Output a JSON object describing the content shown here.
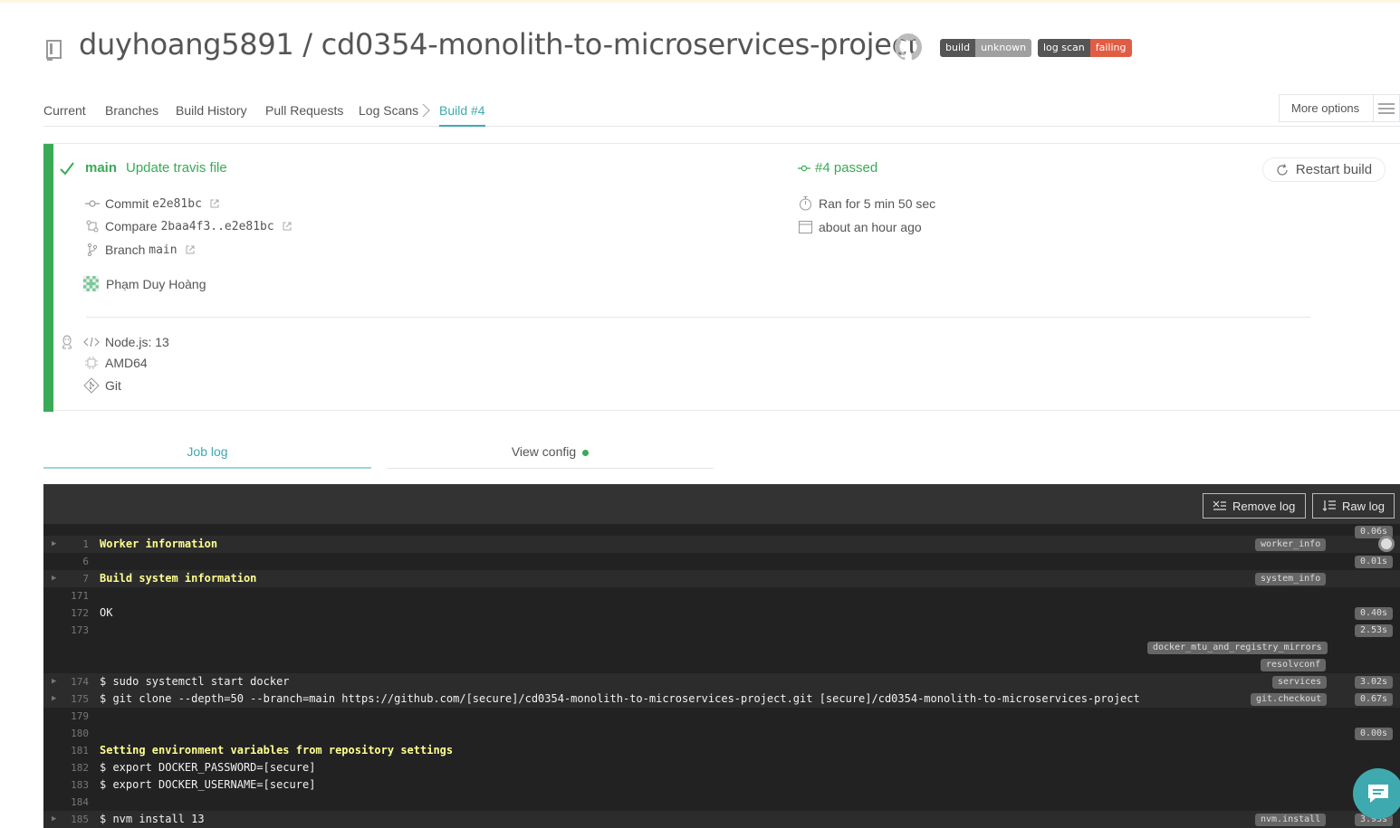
{
  "header": {
    "owner": "duyhoang5891",
    "separator": " / ",
    "repo": "cd0354-monolith-to-microservices-project",
    "badges": [
      {
        "key": "build",
        "value": "unknown",
        "color": "#9f9f9f"
      },
      {
        "key": "log scan",
        "value": "failing",
        "color": "#e05d44"
      }
    ]
  },
  "nav": {
    "tabs": [
      "Current",
      "Branches",
      "Build History",
      "Pull Requests",
      "Log Scans",
      "Build #4"
    ],
    "active": "Build #4",
    "more_options": "More options"
  },
  "build": {
    "status_color": "#39aa56",
    "branch": "main",
    "message": "Update travis file",
    "commit_label": "Commit",
    "commit": "e2e81bc",
    "compare_label": "Compare",
    "compare": "2baa4f3..e2e81bc",
    "branch_label": "Branch",
    "branch_value": "main",
    "author": "Phạm Duy Hoàng",
    "number_status": "#4 passed",
    "duration": "Ran for 5 min 50 sec",
    "finished": "about an hour ago",
    "restart": "Restart build",
    "env": {
      "language": "Node.js: 13",
      "arch": "AMD64",
      "vcs": "Git"
    }
  },
  "log_tabs": {
    "job_log": "Job log",
    "view_config": "View config"
  },
  "log": {
    "remove": "Remove log",
    "raw": "Raw log",
    "lines": [
      {
        "n": "1",
        "text": "Worker information",
        "hl": true,
        "fold": true
      },
      {
        "n": "6",
        "text": ""
      },
      {
        "n": "7",
        "text": "Build system information",
        "hl": true,
        "fold": true
      },
      {
        "n": "171",
        "text": ""
      },
      {
        "n": "172",
        "text": "OK"
      },
      {
        "n": "173",
        "text": ""
      },
      {
        "n": "174",
        "text": "$ sudo systemctl start docker",
        "fold": true
      },
      {
        "n": "175",
        "text": "$ git clone --depth=50 --branch=main https://github.com/[secure]/cd0354-monolith-to-microservices-project.git [secure]/cd0354-monolith-to-microservices-project",
        "fold": true
      },
      {
        "n": "179",
        "text": ""
      },
      {
        "n": "180",
        "text": ""
      },
      {
        "n": "181",
        "text": "Setting environment variables from repository settings",
        "hl": true
      },
      {
        "n": "182",
        "text": "$ export DOCKER_PASSWORD=[secure]"
      },
      {
        "n": "183",
        "text": "$ export DOCKER_USERNAME=[secure]"
      },
      {
        "n": "184",
        "text": ""
      },
      {
        "n": "185",
        "text": "$ nvm install 13",
        "fold": true
      }
    ],
    "tags": [
      "worker_info",
      "system_info",
      "docker_mtu_and_registry_mirrors",
      "resolvconf",
      "services",
      "git.checkout",
      "nvm.install"
    ],
    "times": [
      "0.06s",
      "0.01s",
      "0.40s",
      "2.53s",
      "3.02s",
      "0.67s",
      "0.00s",
      "3.93s"
    ]
  }
}
